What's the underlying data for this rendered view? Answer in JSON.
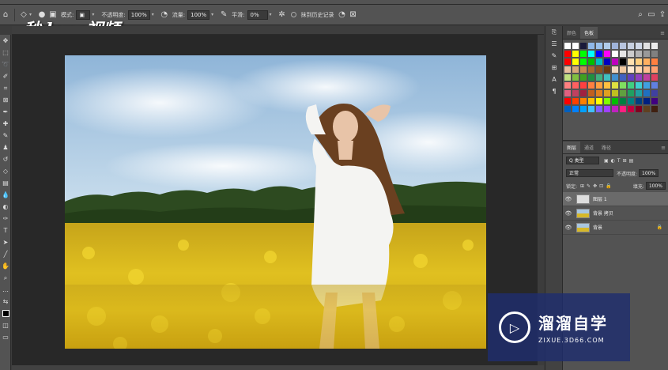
{
  "options_bar": {
    "mode_label": "模式:",
    "opacity_label": "不透明度:",
    "opacity_value": "100%",
    "flow_label": "流量:",
    "flow_value": "100%",
    "smoothing_label": "平滑:",
    "smoothing_value": "0%",
    "history_label": "抹到历史记录"
  },
  "logo_text": "秒dong视频",
  "color_panel": {
    "tabs": [
      "颜色",
      "色板"
    ],
    "active_tab": 1,
    "swatch_rows": [
      [
        "#ffffff",
        "#ffffff",
        "#1a1a3a",
        "#8fb8e8",
        "#9ac0ea",
        "#b0cbe8",
        "#9fb3d8",
        "#b7c4dd",
        "#c7d0e0",
        "#d0d8e6",
        "#e0e0e0",
        "#ececec"
      ],
      [
        "#ff0000",
        "#ffff00",
        "#00ff00",
        "#00ffff",
        "#0000ff",
        "#ff00ff",
        "#ffffff",
        "#e6e6e6",
        "#cccccc",
        "#b3b3b3",
        "#999999",
        "#808080"
      ],
      [
        "#ff0000",
        "#ffff00",
        "#00ff00",
        "#00c000",
        "#00c0c0",
        "#0000c0",
        "#c000c0",
        "#000000",
        "#ffe0b0",
        "#ffd080",
        "#ffb060",
        "#ff8040"
      ],
      [
        "#e8c0a0",
        "#d8a878",
        "#c88850",
        "#a86830",
        "#885020",
        "#683810",
        "#f0d8c0",
        "#f0c8a0",
        "#ffe8d0",
        "#ffd8b0",
        "#ffc090",
        "#ffa070"
      ],
      [
        "#c0e080",
        "#80c040",
        "#40a020",
        "#209040",
        "#40b080",
        "#40c0c0",
        "#4090d0",
        "#4060c0",
        "#6040c0",
        "#9040c0",
        "#c040a0",
        "#e04060"
      ],
      [
        "#ff8080",
        "#ff6060",
        "#ff4040",
        "#ff8040",
        "#ffa040",
        "#ffc040",
        "#e0e040",
        "#80e060",
        "#40d080",
        "#40d0d0",
        "#40a0e0",
        "#6080e0"
      ],
      [
        "#e06080",
        "#c04060",
        "#a02040",
        "#c06020",
        "#e08020",
        "#e0a020",
        "#c0c020",
        "#60a040",
        "#20a060",
        "#20a0a0",
        "#2070c0",
        "#4040a0"
      ],
      [
        "#ff0000",
        "#ff4000",
        "#ff8000",
        "#ffc000",
        "#ffff00",
        "#80ff00",
        "#00c000",
        "#008040",
        "#008080",
        "#004080",
        "#002080",
        "#400080"
      ],
      [
        "#0060c0",
        "#0080ff",
        "#00a0ff",
        "#40c0ff",
        "#8060ff",
        "#a040ff",
        "#c020c0",
        "#ff2080",
        "#c00040",
        "#800020",
        "#604020",
        "#402010"
      ]
    ]
  },
  "layers_panel": {
    "tabs": [
      "图层",
      "通道",
      "路径"
    ],
    "active_tab": 0,
    "kind_label": "Q 类型",
    "blend_mode": "正常",
    "opacity_label": "不透明度:",
    "opacity_value": "100%",
    "lock_label": "锁定:",
    "fill_label": "填充:",
    "fill_value": "100%",
    "layers": [
      {
        "name": "图层 1",
        "selected": true,
        "locked": false
      },
      {
        "name": "背景 拷贝",
        "selected": false,
        "locked": false
      },
      {
        "name": "背景",
        "selected": false,
        "locked": true
      }
    ]
  },
  "watermark": {
    "title": "溜溜自学",
    "url": "ZIXUE.3D66.COM"
  },
  "colors": {
    "panel_bg": "#535353",
    "canvas_bg": "#282828",
    "watermark_bg": "#1e2d6e"
  }
}
